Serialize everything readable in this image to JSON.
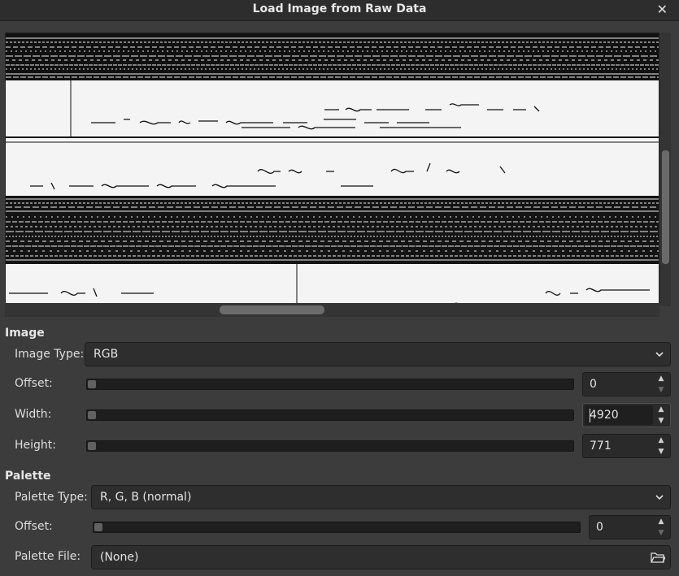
{
  "dialog": {
    "title": "Load Image from Raw Data",
    "close_glyph": "✕"
  },
  "image_section": {
    "heading": "Image",
    "type_label": "Image Type:",
    "type_value": "RGB",
    "offset_label": "Offset:",
    "offset_value": "0",
    "width_label": "Width:",
    "width_value": "4920",
    "height_label": "Height:",
    "height_value": "771"
  },
  "palette_section": {
    "heading": "Palette",
    "type_label": "Palette Type:",
    "type_value": "R, G, B (normal)",
    "offset_label": "Offset:",
    "offset_value": "0",
    "file_label": "Palette File:",
    "file_value": "(None)"
  },
  "icons": {
    "close": "close-icon",
    "chevron": "chevron-down-icon",
    "spin_up": "spin-up-icon",
    "spin_down": "spin-down-icon",
    "file": "open-file-icon"
  },
  "colors": {
    "background": "#3c3c3c",
    "titlebar": "#2d2d2d",
    "entry": "#2e2e2e",
    "text": "#dedede"
  }
}
